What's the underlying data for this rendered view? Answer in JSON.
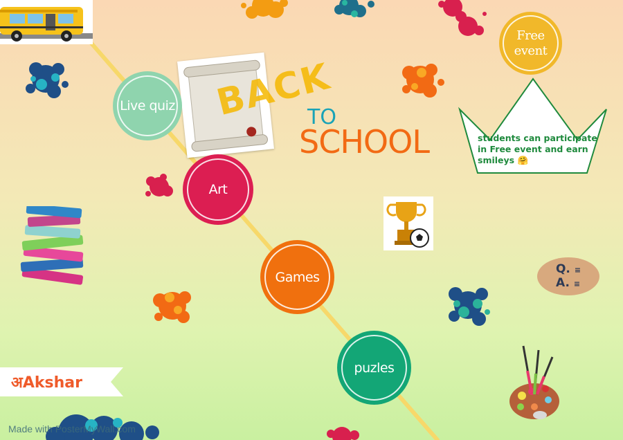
{
  "poster": {
    "title_back": "BACK",
    "title_to": "TO",
    "title_school": "SCHOOL",
    "colors": {
      "yellow": "#f5b800",
      "orange": "#f26a14",
      "accent": "#1f8a3d"
    }
  },
  "activities": [
    {
      "label": "Live quiz",
      "color": "#8fd4ae"
    },
    {
      "label": "Art",
      "color": "#dc1e52"
    },
    {
      "label": "Games",
      "color": "#f0700e"
    },
    {
      "label": "puzles",
      "color": "#13a676"
    }
  ],
  "free_event": {
    "label_line1": "Free",
    "label_line2": "event",
    "color": "#f1b82a"
  },
  "crown": {
    "text": "students can participate in Free event and earn smileys 🤗"
  },
  "qa": {
    "q": "Q.",
    "a": "A."
  },
  "brand": {
    "prefix": "अ",
    "name": "Akshar"
  },
  "footer": {
    "text": "Made with PosterMyWall.com"
  },
  "icons": [
    "school-bus-icon",
    "scroll-icon",
    "trophy-ball-icon",
    "books-stack-icon",
    "paint-palette-icon",
    "qa-icon"
  ]
}
